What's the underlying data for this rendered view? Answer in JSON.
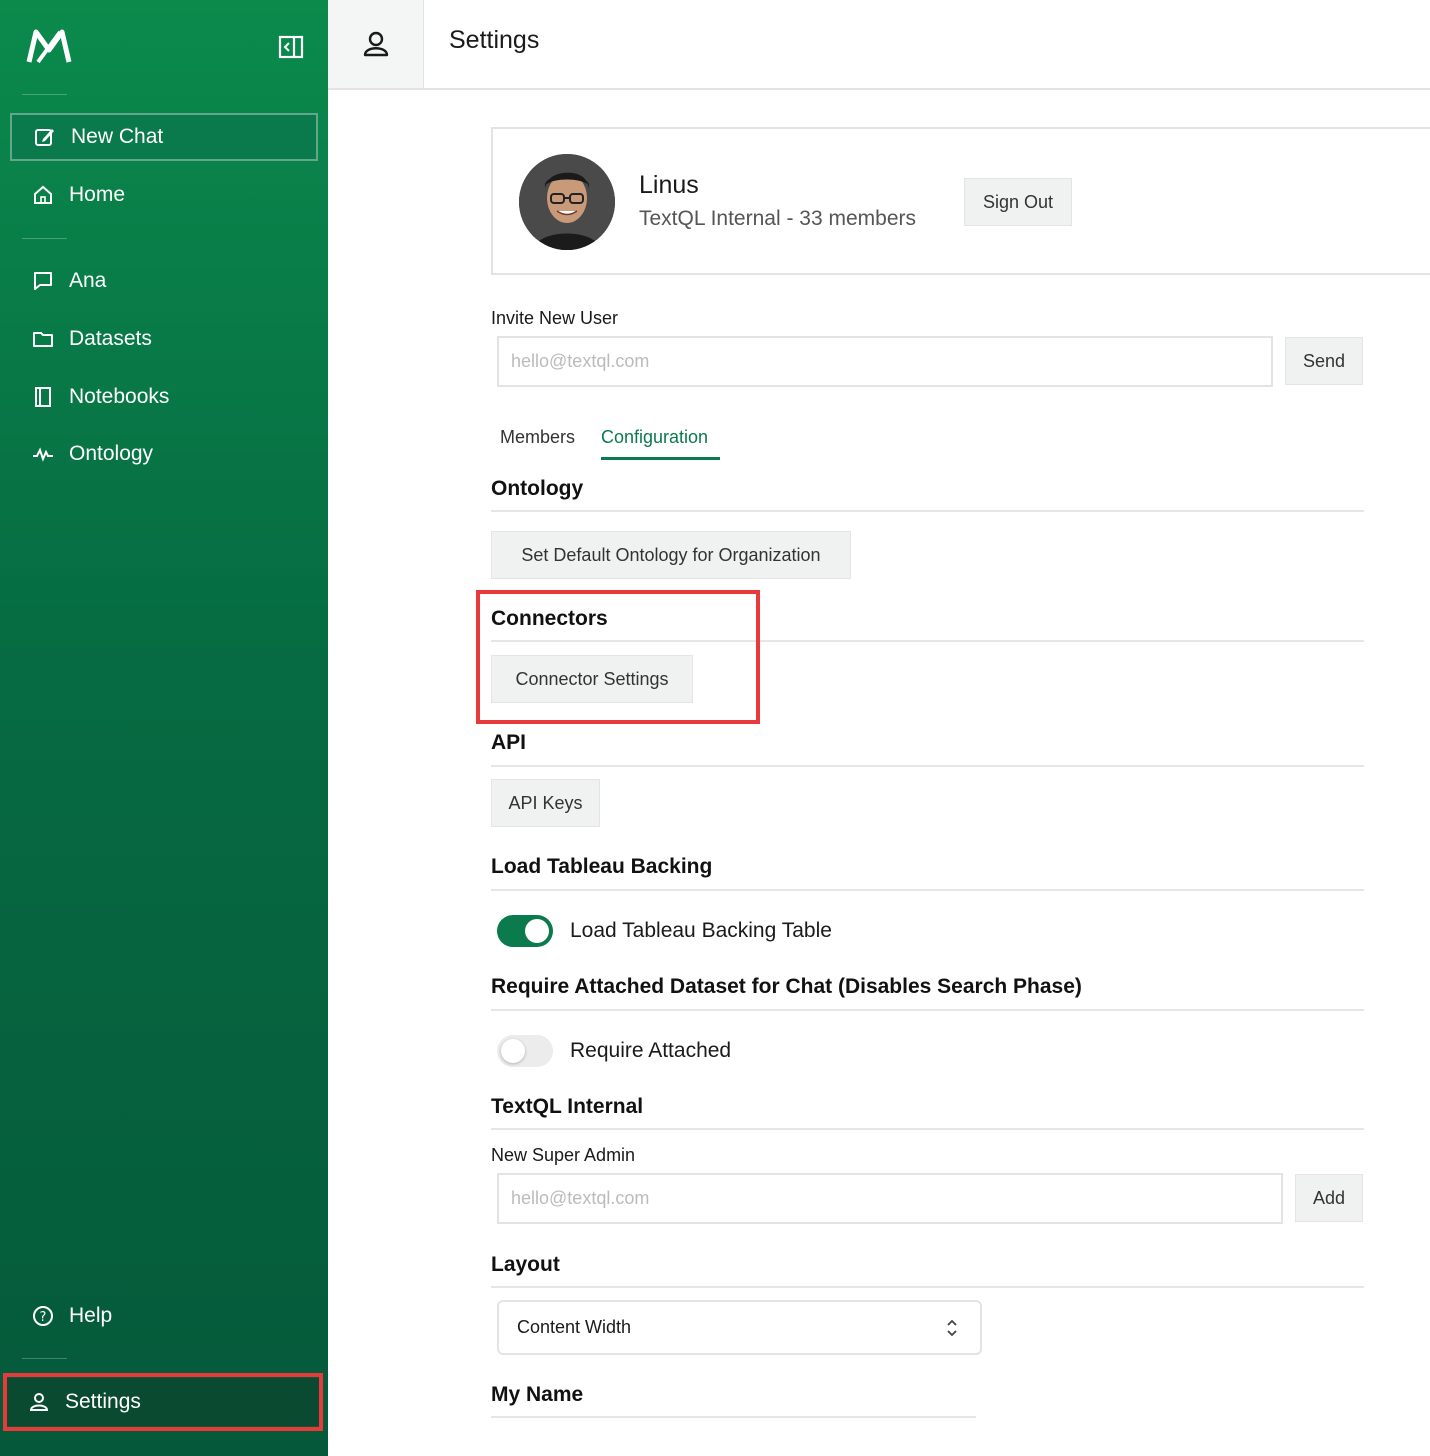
{
  "app": {
    "logo_name": "textql-logo",
    "header_title": "Settings",
    "brand_colors": {
      "sidebar": "#066b42",
      "accent": "#0b7a4c",
      "highlight": "#e83a3a"
    }
  },
  "sidebar": {
    "new_chat": "New Chat",
    "home": "Home",
    "items": [
      {
        "label": "Ana",
        "icon": "chat-icon"
      },
      {
        "label": "Datasets",
        "icon": "folder-icon"
      },
      {
        "label": "Notebooks",
        "icon": "notebook-icon"
      },
      {
        "label": "Ontology",
        "icon": "ontology-icon"
      }
    ],
    "help": "Help",
    "settings": "Settings"
  },
  "profile": {
    "name": "Linus",
    "org": "TextQL Internal - 33 members",
    "sign_out": "Sign Out"
  },
  "invite": {
    "label": "Invite New User",
    "placeholder": "hello@textql.com",
    "send": "Send"
  },
  "tabs": [
    {
      "label": "Members",
      "active": false
    },
    {
      "label": "Configuration",
      "active": true
    }
  ],
  "sections": {
    "ontology": {
      "title": "Ontology",
      "button": "Set Default Ontology for Organization"
    },
    "connectors": {
      "title": "Connectors",
      "button": "Connector Settings"
    },
    "api": {
      "title": "API",
      "button": "API Keys"
    },
    "tableau": {
      "title": "Load Tableau Backing",
      "toggle_label": "Load Tableau Backing Table",
      "enabled": true
    },
    "require": {
      "title": "Require Attached Dataset for Chat (Disables Search Phase)",
      "toggle_label": "Require Attached",
      "enabled": false
    },
    "internal": {
      "title": "TextQL Internal",
      "field_label": "New Super Admin",
      "placeholder": "hello@textql.com",
      "add": "Add"
    },
    "layout": {
      "title": "Layout",
      "selected": "Content Width"
    },
    "my_name": {
      "title": "My Name"
    }
  }
}
